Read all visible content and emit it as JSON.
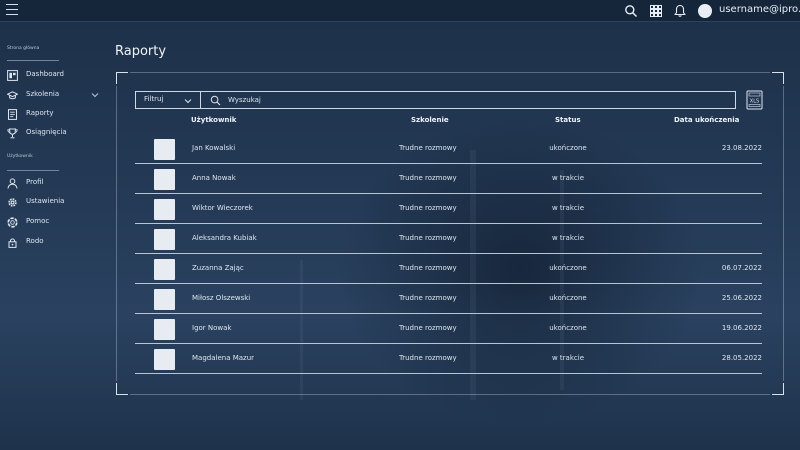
{
  "topbar": {
    "username": "username@ipro.pl",
    "icons": [
      "search-icon",
      "apps-grid-icon",
      "bell-icon",
      "avatar"
    ]
  },
  "sidebar": {
    "sections": [
      {
        "label": "Strona główna",
        "items": [
          {
            "label": "Dashboard",
            "icon": "dashboard-icon"
          },
          {
            "label": "Szkolenia",
            "icon": "graduation-cap-icon",
            "expandable": true
          },
          {
            "label": "Raporty",
            "icon": "report-icon"
          },
          {
            "label": "Osiągnięcia",
            "icon": "trophy-icon"
          }
        ]
      },
      {
        "label": "Użytkownik",
        "items": [
          {
            "label": "Profil",
            "icon": "user-icon"
          },
          {
            "label": "Ustawienia",
            "icon": "gear-icon"
          },
          {
            "label": "Pomoc",
            "icon": "help-icon"
          },
          {
            "label": "Rodo",
            "icon": "lock-icon"
          }
        ]
      }
    ]
  },
  "page": {
    "title": "Raporty"
  },
  "toolbar": {
    "filter_label": "Filtruj",
    "search_placeholder": "Wyszukaj",
    "export_label": "XLS"
  },
  "table": {
    "columns": [
      "Użytkownik",
      "Szkolenie",
      "Status",
      "Data ukończenia"
    ],
    "rows": [
      {
        "user": "Jan Kowalski",
        "training": "Trudne rozmowy",
        "status": "ukończone",
        "date": "23.08.2022"
      },
      {
        "user": "Anna Nowak",
        "training": "Trudne rozmowy",
        "status": "w trakcie",
        "date": ""
      },
      {
        "user": "Wiktor Wieczorek",
        "training": "Trudne rozmowy",
        "status": "w trakcie",
        "date": ""
      },
      {
        "user": "Aleksandra Kubiak",
        "training": "Trudne rozmowy",
        "status": "w trakcie",
        "date": ""
      },
      {
        "user": "Zuzanna Zając",
        "training": "Trudne rozmowy",
        "status": "ukończone",
        "date": "06.07.2022"
      },
      {
        "user": "Miłosz Olszewski",
        "training": "Trudne rozmowy",
        "status": "ukończone",
        "date": "25.06.2022"
      },
      {
        "user": "Igor Nowak",
        "training": "Trudne rozmowy",
        "status": "ukończone",
        "date": "19.06.2022"
      },
      {
        "user": "Magdalena Mazur",
        "training": "Trudne rozmowy",
        "status": "w trakcie",
        "date": "28.05.2022"
      }
    ]
  },
  "colors": {
    "background": "#243a56",
    "topbar": "#15263b",
    "text": "#e6edf5",
    "divider": "#b7c6d6"
  }
}
